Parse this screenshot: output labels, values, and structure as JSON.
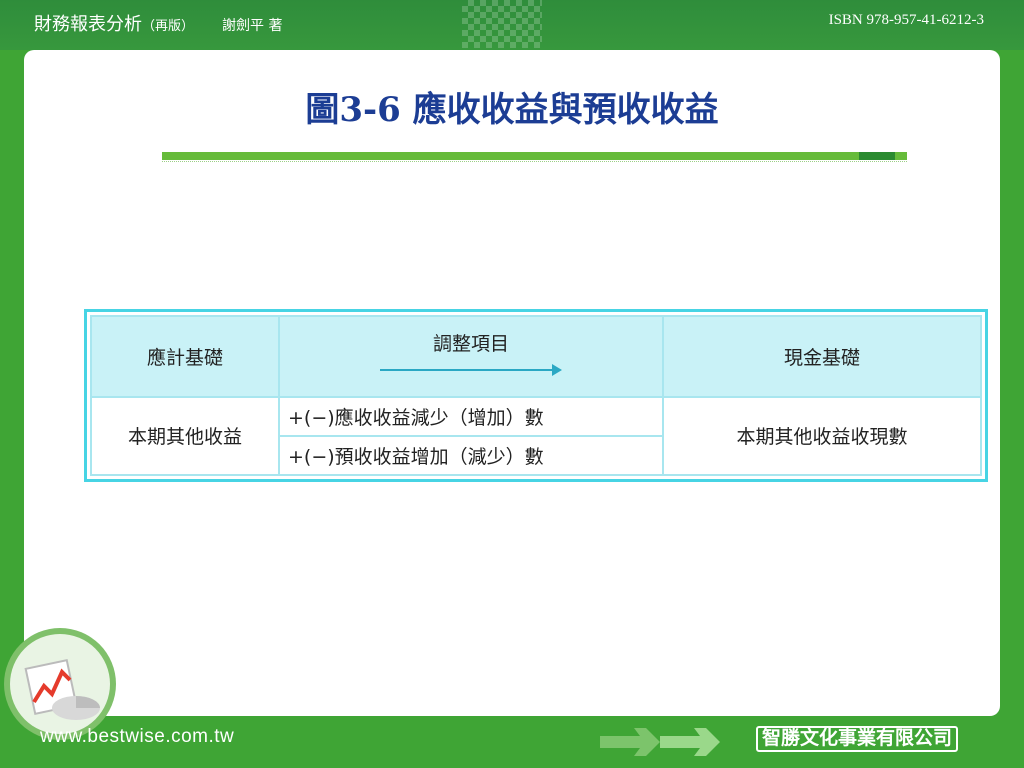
{
  "header": {
    "book_title": "財務報表分析",
    "edition": "（再版）",
    "author": "謝劍平 著",
    "isbn": "ISBN 978-957-41-6212-3"
  },
  "slide": {
    "title": "圖3-6 應收收益與預收收益"
  },
  "table": {
    "col1_header": "應計基礎",
    "col2_header": "調整項目",
    "col3_header": "現金基礎",
    "row_label": "本期其他收益",
    "adjustment_1": "+(−)應收收益減少（增加）數",
    "adjustment_2": "+(−)預收收益增加（減少）數",
    "result": "本期其他收益收現數"
  },
  "footer": {
    "url": "www.bestwise.com.tw",
    "publisher": "智勝文化事業有限公司"
  },
  "colors": {
    "green_bg": "#3fa535",
    "title_blue": "#1c3d94",
    "table_border": "#47d4e4",
    "header_fill": "#c9f2f7"
  },
  "icons": {
    "logo": "chart-logo-icon",
    "arrows": "double-arrow-icon"
  }
}
